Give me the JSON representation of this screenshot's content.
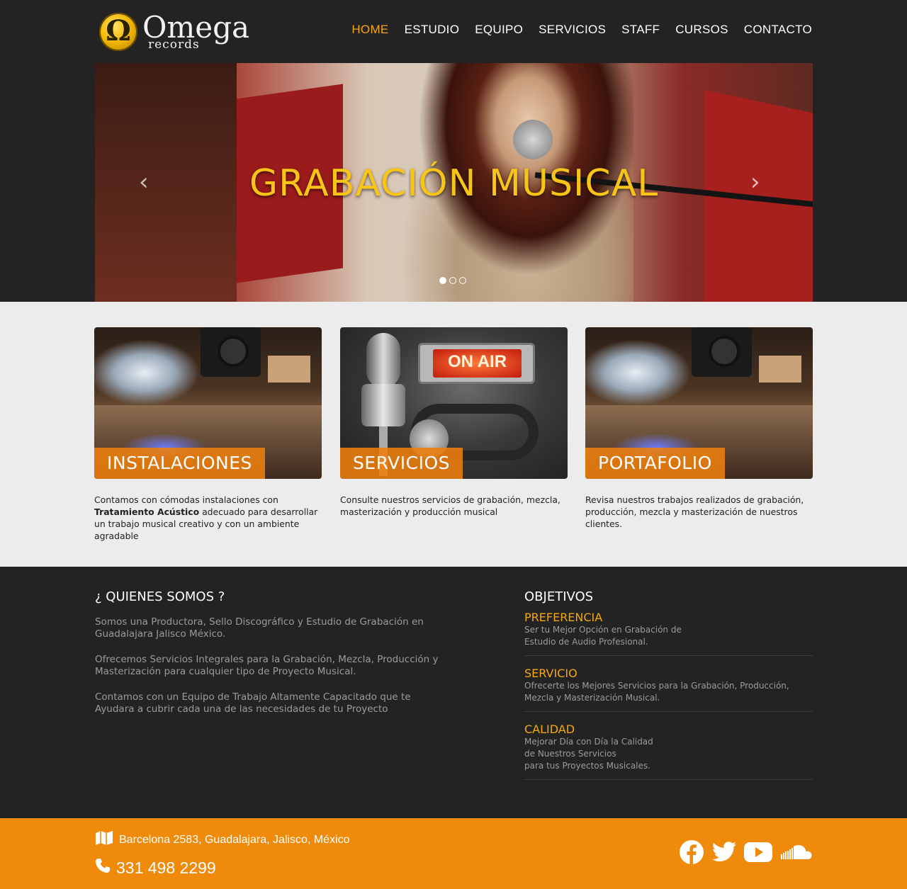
{
  "brand": {
    "name": "Omega",
    "sub": "records",
    "symbol": "Ω",
    "accent": "#f6a70f",
    "footer_color": "#ef8a0b"
  },
  "nav": [
    {
      "label": "HOME",
      "active": true
    },
    {
      "label": "ESTUDIO"
    },
    {
      "label": "EQUIPO"
    },
    {
      "label": "SERVICIOS"
    },
    {
      "label": "STAFF"
    },
    {
      "label": "CURSOS"
    },
    {
      "label": "CONTACTO"
    }
  ],
  "hero": {
    "title": "GRABACIÓN MUSICAL",
    "prev_icon": "‹",
    "next_icon": "›",
    "slide_count": 3,
    "active_slide": 1
  },
  "cards": [
    {
      "label": "INSTALACIONES",
      "text_before": "Contamos con cómodas instalaciones con ",
      "text_bold": "Tratamiento Acústico",
      "text_after": " adecuado para desarrollar un trabajo musical creativo y con un ambiente agradable"
    },
    {
      "label": "SERVICIOS",
      "text": "Consulte nuestros servicios de grabación, mezcla, masterización y producción musical",
      "sign": "ON AIR"
    },
    {
      "label": "PORTAFOLIO",
      "text": "Revisa nuestros trabajos realizados de grabación, producción, mezcla y masterización de nuestros clientes."
    }
  ],
  "about": {
    "title": "¿ QUIENES SOMOS ?",
    "paragraphs": [
      "Somos una Productora, Sello Discográfico y Estudio de Grabación en Guadalajara Jalisco México.",
      "Ofrecemos Servicios Integrales para la Grabación, Mezcla, Producción y Masterización para cualquier tipo de Proyecto Musical.",
      "Contamos con un Equipo de Trabajo Altamente Capacitado que te Ayudara a cubrir cada una de las necesidades de tu Proyecto"
    ]
  },
  "goals": {
    "title": "OBJETIVOS",
    "items": [
      {
        "title": "PREFERENCIA",
        "text": "Ser tu Mejor Opción en Grabación de\nEstudio de Audio Profesional."
      },
      {
        "title": "SERVICIO",
        "text": "Ofrecerte los Mejores Servicios para la Grabación, Producción,\nMezcla y Masterización Musical."
      },
      {
        "title": "CALIDAD",
        "text": "Mejorar Día con Día la Calidad\nde Nuestros Servicios\npara tus Proyectos Musicales."
      }
    ]
  },
  "footer": {
    "address": "Barcelona 2583, Guadalajara, Jalisco, México",
    "phone": "331 498 2299",
    "icons": [
      "map-icon",
      "phone-icon",
      "facebook-icon",
      "twitter-icon",
      "youtube-icon",
      "soundcloud-icon"
    ]
  }
}
